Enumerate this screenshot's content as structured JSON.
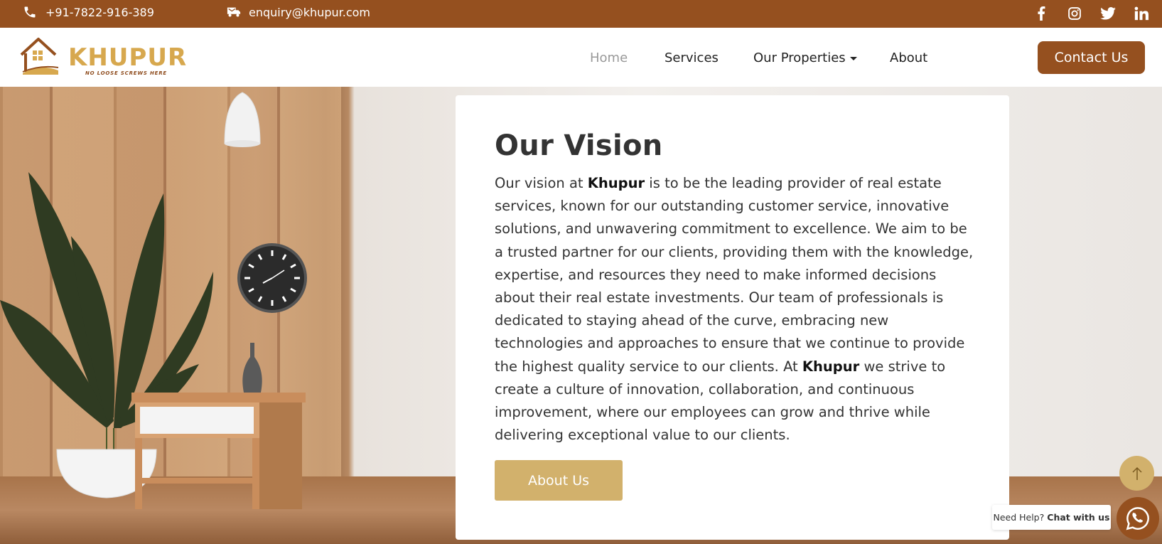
{
  "topbar": {
    "phone": "+91-7822-916-389",
    "email": "enquiry@khupur.com",
    "socials": [
      "facebook-icon",
      "instagram-icon",
      "twitter-icon",
      "linkedin-icon"
    ],
    "background": "#95501f"
  },
  "logo": {
    "word": "KHUPUR",
    "tagline": "NO LOOSE SCREWS HERE"
  },
  "nav": {
    "home": "Home",
    "services": "Services",
    "properties": "Our Properties",
    "about": "About",
    "contact_button": "Contact Us"
  },
  "vision": {
    "title": "Our Vision",
    "p1": "Our vision at ",
    "brand1": "Khupur",
    "p2": " is to be the leading provider of real estate services, known for our outstanding customer service, innovative solutions, and unwavering commitment to excellence. We aim to be a trusted partner for our clients, providing them with the knowledge, expertise, and resources they need to make informed decisions about their real estate investments. Our team of professionals is dedicated to staying ahead of the curve, embracing new technologies and approaches to ensure that we continue to provide the highest quality service to our clients. At ",
    "brand2": "Khupur",
    "p3": " we strive to create a culture of innovation, collaboration, and continuous improvement, where our employees can grow and thrive while delivering exceptional value to our clients.",
    "button": "About Us"
  },
  "chat": {
    "need_help": "Need Help?",
    "chat_with_us": "Chat with us"
  },
  "colors": {
    "brand_brown": "#95501f",
    "accent_gold": "#d2b16c"
  }
}
